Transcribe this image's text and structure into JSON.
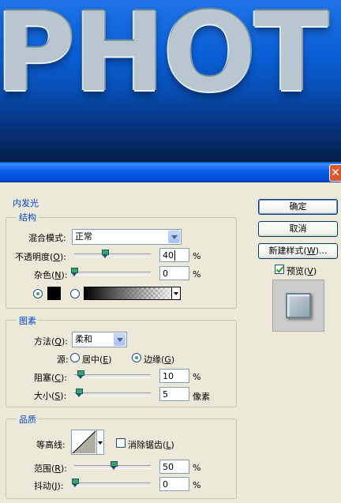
{
  "preview_text": "PHOT",
  "colors": {
    "accent": "#0046d5",
    "titlebar": "#0058e6",
    "close": "#d9582e"
  },
  "dialog": {
    "close_icon": "close-icon",
    "section_title": "内发光",
    "structure": {
      "legend": "结构",
      "blend_mode_label": "混合模式:",
      "blend_mode_value": "正常",
      "opacity_label_a": "不透明度(",
      "opacity_key": "O",
      "opacity_label_b": "):",
      "opacity_value": "40",
      "opacity_level_percent": 40,
      "opacity_unit": "%",
      "noise_label_a": "杂色(",
      "noise_key": "N",
      "noise_label_b": "):",
      "noise_value": "0",
      "noise_level_percent": 0,
      "noise_unit": "%"
    },
    "elements": {
      "legend": "图素",
      "method_label_a": "方法(",
      "method_key": "Q",
      "method_label_b": "):",
      "method_value": "柔和",
      "source_label": "源:",
      "center_label_a": "居中(",
      "center_key": "E",
      "center_label_b": ")",
      "edge_label_a": "边缘(",
      "edge_key": "G",
      "edge_label_b": ")",
      "choke_label_a": "阻塞(",
      "choke_key": "C",
      "choke_label_b": "):",
      "choke_value": "10",
      "choke_unit": "%",
      "size_label_a": "大小(",
      "size_key": "S",
      "size_label_b": "):",
      "size_value": "5",
      "size_unit": "像素"
    },
    "quality": {
      "legend": "品质",
      "contour_label": "等高线:",
      "antialias_label_a": "消除锯齿(",
      "antialias_key": "L",
      "antialias_label_b": ")",
      "range_label_a": "范围(",
      "range_key": "R",
      "range_label_b": "):",
      "range_value": "50",
      "range_unit": "%",
      "jitter_label_a": "抖动(",
      "jitter_key": "J",
      "jitter_label_b": "):",
      "jitter_value": "0",
      "jitter_unit": "%"
    },
    "buttons": {
      "ok": "确定",
      "cancel": "取消",
      "new_style_a": "新建样式(",
      "new_style_key": "W",
      "new_style_b": ")...",
      "preview_a": "预览(",
      "preview_key": "V",
      "preview_b": ")"
    }
  }
}
